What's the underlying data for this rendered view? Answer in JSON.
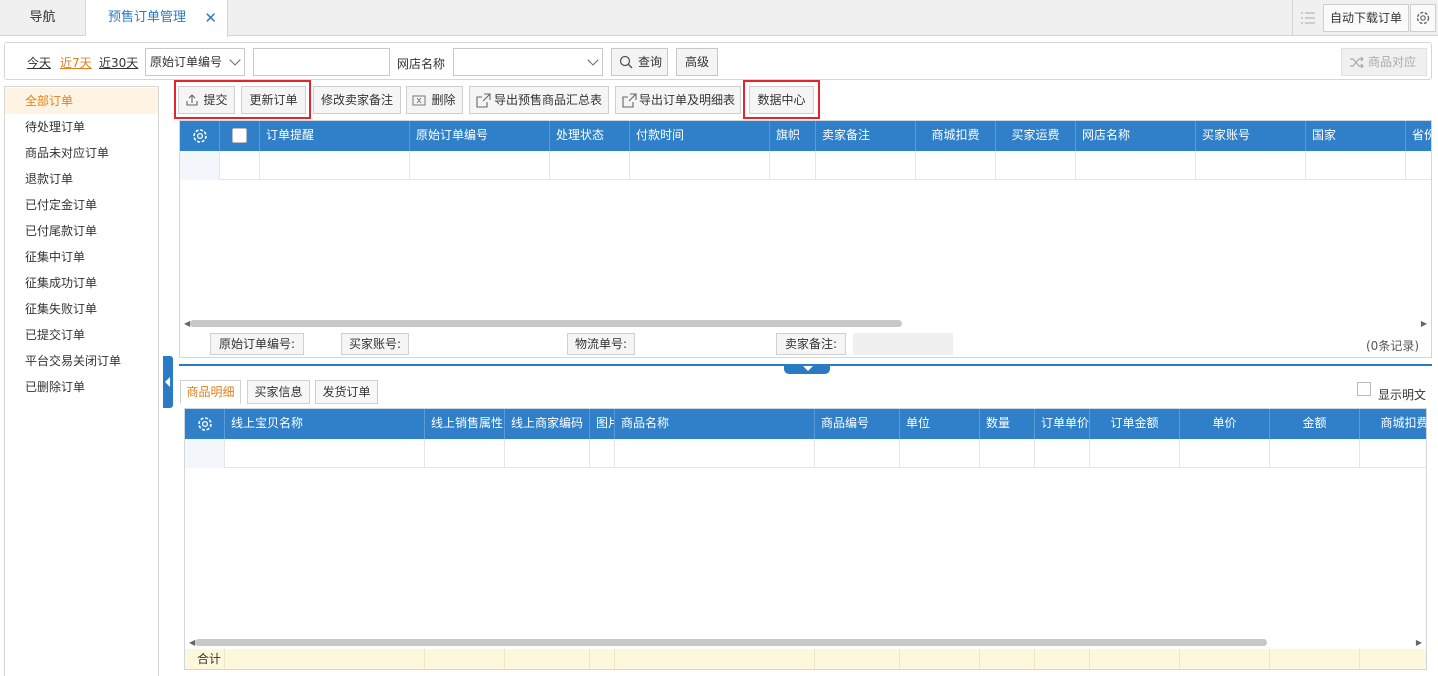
{
  "tabs": {
    "nav": "导航",
    "active": "预售订单管理",
    "close": "✕"
  },
  "top_right": {
    "auto_download": "自动下载订单"
  },
  "filter": {
    "today": "今天",
    "last7": "近7天",
    "last30": "近30天",
    "search_field": "原始订单编号",
    "search_value": "",
    "shop_label": "网店名称",
    "shop_value": "",
    "query": "查询",
    "advanced": "高级",
    "product_match": "商品对应"
  },
  "sidebar": {
    "items": [
      {
        "label": "全部订单",
        "active": true
      },
      {
        "label": "待处理订单"
      },
      {
        "label": "商品未对应订单"
      },
      {
        "label": "退款订单"
      },
      {
        "label": "已付定金订单"
      },
      {
        "label": "已付尾款订单"
      },
      {
        "label": "征集中订单"
      },
      {
        "label": "征集成功订单"
      },
      {
        "label": "征集失败订单"
      },
      {
        "label": "已提交订单"
      },
      {
        "label": "平台交易关闭订单"
      },
      {
        "label": "已删除订单"
      }
    ]
  },
  "toolbar": {
    "submit": "提交",
    "update": "更新订单",
    "edit_remark": "修改卖家备注",
    "delete": "删除",
    "export_summary": "导出预售商品汇总表",
    "export_detail": "导出订单及明细表",
    "data_center": "数据中心"
  },
  "grid1": {
    "columns": [
      "订单提醒",
      "原始订单编号",
      "处理状态",
      "付款时间",
      "旗帜",
      "卖家备注",
      "商城扣费",
      "买家运费",
      "网店名称",
      "买家账号",
      "国家",
      "省份"
    ],
    "footer": {
      "orig_no": "原始订单编号:",
      "buyer_acct": "买家账号:",
      "logistics_no": "物流单号:",
      "seller_remark": "卖家备注:",
      "records": "(0条记录)"
    }
  },
  "lower_tabs": [
    "商品明细",
    "买家信息",
    "发货订单"
  ],
  "show_plain": "显示明文",
  "grid2": {
    "columns": [
      "线上宝贝名称",
      "线上销售属性",
      "线上商家编码",
      "图片",
      "商品名称",
      "商品编号",
      "单位",
      "数量",
      "订单单价",
      "订单金额",
      "单价",
      "金额",
      "商城扣费"
    ],
    "sum_label": "合计"
  },
  "colors": {
    "accent": "#2f80c9",
    "highlight": "#e2262b",
    "active_orange": "#e0801c"
  }
}
